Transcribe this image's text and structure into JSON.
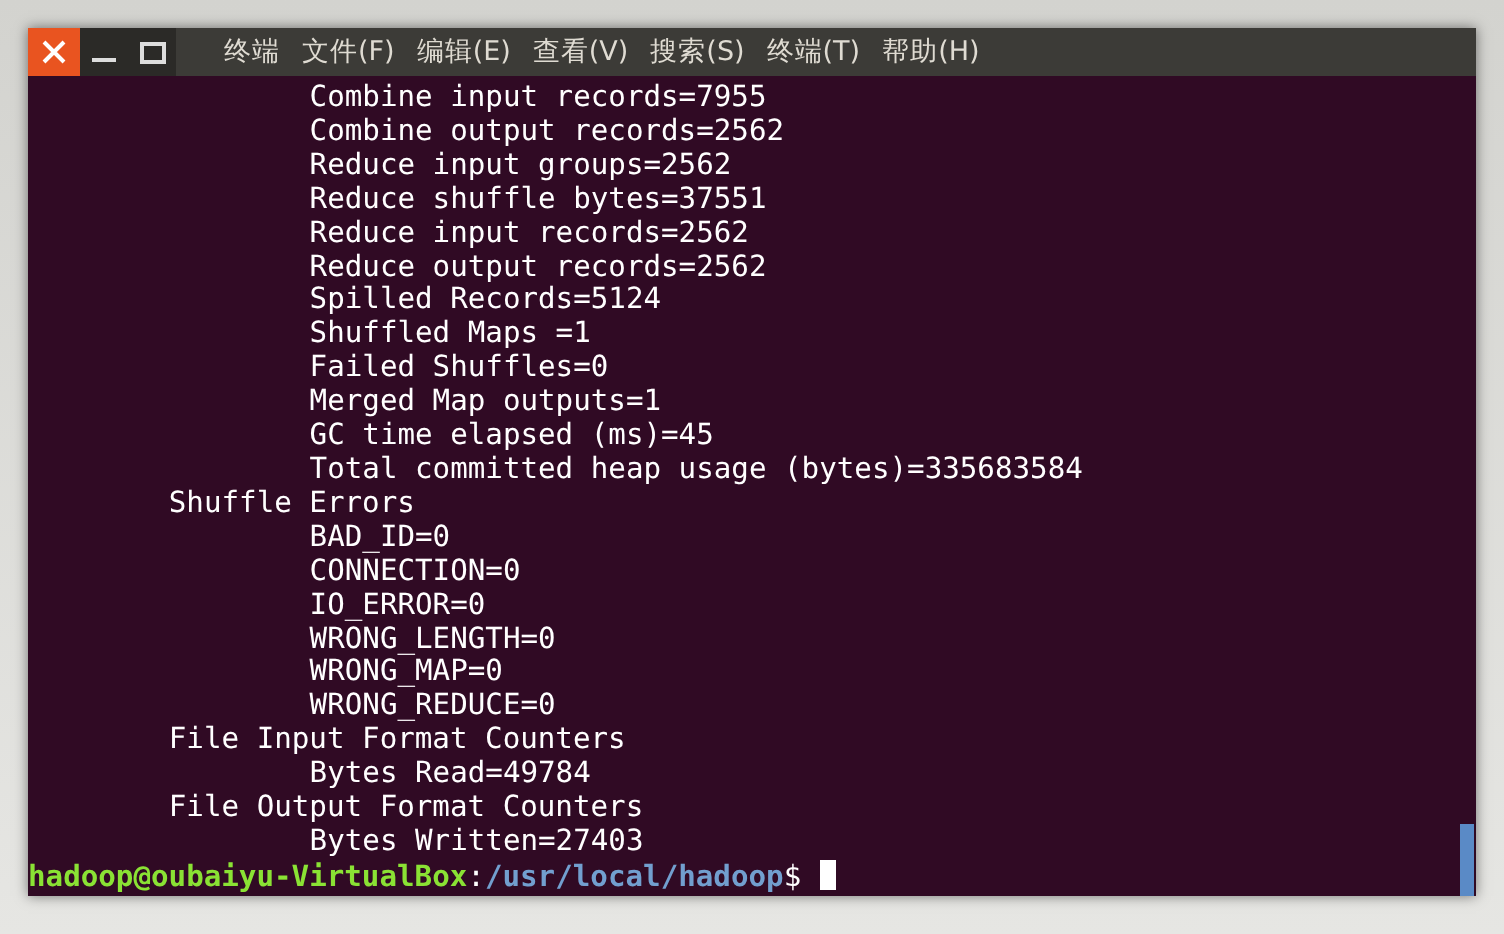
{
  "window": {
    "menu": [
      "终端",
      "文件(F)",
      "编辑(E)",
      "查看(V)",
      "搜索(S)",
      "终端(T)",
      "帮助(H)"
    ]
  },
  "output": [
    {
      "lines": [
        "Combine input records=7955",
        "Combine output records=2562",
        "Reduce input groups=2562",
        "Reduce shuffle bytes=37551",
        "Reduce input records=2562",
        "Reduce output records=2562",
        "Spilled Records=5124",
        "Shuffled Maps =1",
        "Failed Shuffles=0",
        "Merged Map outputs=1",
        "GC time elapsed (ms)=45",
        "Total committed heap usage (bytes)=335683584"
      ]
    },
    {
      "heading": "Shuffle Errors",
      "lines": [
        "BAD_ID=0",
        "CONNECTION=0",
        "IO_ERROR=0",
        "WRONG_LENGTH=0",
        "WRONG_MAP=0",
        "WRONG_REDUCE=0"
      ]
    },
    {
      "heading": "File Input Format Counters",
      "lines": [
        "Bytes Read=49784"
      ]
    },
    {
      "heading": "File Output Format Counters",
      "lines": [
        "Bytes Written=27403"
      ]
    }
  ],
  "prompt": {
    "user": "hadoop@oubaiyu-VirtualBox",
    "separator": ":",
    "path": "/usr/local/hadoop",
    "symbol": "$"
  }
}
